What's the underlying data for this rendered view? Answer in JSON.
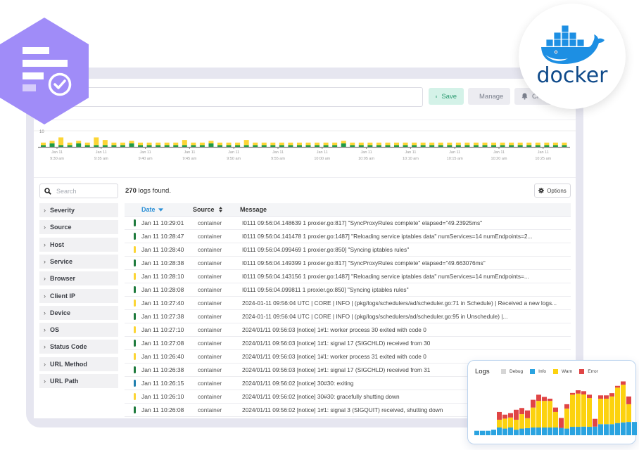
{
  "toolbar": {
    "query_value": "",
    "save_label": "Save",
    "manage_label": "Manage",
    "create_label": "Cr"
  },
  "histogram": {
    "type": "bar",
    "y_tick": "10",
    "ymax": 10,
    "x_ticks": [
      {
        "line1": "Jan 11",
        "line2": "9:30 am"
      },
      {
        "line1": "Jan 11",
        "line2": "9:35 am"
      },
      {
        "line1": "Jan 11",
        "line2": "9:40 am"
      },
      {
        "line1": "Jan 11",
        "line2": "9:45 am"
      },
      {
        "line1": "Jan 11",
        "line2": "9:50 am"
      },
      {
        "line1": "Jan 11",
        "line2": "9:55 am"
      },
      {
        "line1": "Jan 11",
        "line2": "10:00 am"
      },
      {
        "line1": "Jan 11",
        "line2": "10:05 am"
      },
      {
        "line1": "Jan 11",
        "line2": "10:10 am"
      },
      {
        "line1": "Jan 11",
        "line2": "10:15 am"
      },
      {
        "line1": "Jan 11",
        "line2": "10:20 am"
      },
      {
        "line1": "Jan 11",
        "line2": "10:25 am"
      }
    ],
    "colors": {
      "info": "#1e9b45",
      "warn": "#fcd535"
    },
    "info": [
      1,
      2,
      1,
      1,
      2,
      1,
      1,
      1,
      1,
      1,
      2,
      1,
      1,
      1,
      1,
      1,
      1,
      1,
      1,
      2,
      1,
      1,
      1,
      1,
      1,
      1,
      1,
      1,
      1,
      1,
      1,
      1,
      1,
      1,
      2,
      1,
      1,
      1,
      1,
      1,
      1,
      1,
      1,
      1,
      1,
      1,
      1,
      1,
      1,
      1,
      1,
      1,
      1,
      1,
      1,
      1,
      1,
      1,
      1,
      1
    ],
    "warn": [
      1,
      1,
      3,
      1,
      1,
      1,
      3,
      2,
      1,
      1,
      1,
      1,
      1,
      1,
      1,
      1,
      2,
      1,
      1,
      1,
      1,
      1,
      1,
      2,
      1,
      1,
      1,
      1,
      1,
      1,
      1,
      1,
      1,
      1,
      1,
      1,
      1,
      1,
      1,
      1,
      1,
      1,
      1,
      1,
      1,
      1,
      1,
      1,
      1,
      1,
      1,
      1,
      1,
      1,
      1,
      1,
      1,
      1,
      1,
      1
    ]
  },
  "sidebar": {
    "search_placeholder": "Search",
    "facets": [
      "Severity",
      "Source",
      "Host",
      "Service",
      "Browser",
      "Client IP",
      "Device",
      "OS",
      "Status Code",
      "URL Method",
      "URL Path"
    ]
  },
  "results": {
    "count": "270",
    "count_suffix": " logs found.",
    "options_label": "Options",
    "columns": {
      "date": "Date",
      "source": "Source",
      "message": "Message"
    },
    "severity_colors": {
      "info": "#1e7a3c",
      "warn": "#fcd535",
      "debug": "#1f7fae"
    },
    "rows": [
      {
        "sev": "info",
        "date": "Jan 11 10:29:01",
        "source": "container",
        "message": "I0111 09:56:04.148639 1 proxier.go:817] \"SyncProxyRules complete\" elapsed=\"49.23925ms\""
      },
      {
        "sev": "info",
        "date": "Jan 11 10:28:47",
        "source": "container",
        "message": "I0111 09:56:04.141478 1 proxier.go:1487] \"Reloading service iptables data\" numServices=14 numEndpoints=2..."
      },
      {
        "sev": "warn",
        "date": "Jan 11 10:28:40",
        "source": "container",
        "message": "I0111 09:56:04.099469 1 proxier.go:850] \"Syncing iptables rules\""
      },
      {
        "sev": "info",
        "date": "Jan 11 10:28:38",
        "source": "container",
        "message": "I0111 09:56:04.149399 1 proxier.go:817] \"SyncProxyRules complete\" elapsed=\"49.663076ms\""
      },
      {
        "sev": "warn",
        "date": "Jan 11 10:28:10",
        "source": "container",
        "message": "I0111 09:56:04.143156 1 proxier.go:1487] \"Reloading service iptables data\" numServices=14 numEndpoints=..."
      },
      {
        "sev": "info",
        "date": "Jan 11 10:28:08",
        "source": "container",
        "message": "I0111 09:56:04.099811 1 proxier.go:850] \"Syncing iptables rules\""
      },
      {
        "sev": "warn",
        "date": "Jan 11 10:27:40",
        "source": "container",
        "message": "2024-01-11 09:56:04 UTC | CORE | INFO | (pkg/logs/schedulers/ad/scheduler.go:71 in Schedule) | Received a new logs..."
      },
      {
        "sev": "info",
        "date": "Jan 11 10:27:38",
        "source": "container",
        "message": "2024-01-11 09:56:04 UTC | CORE | INFO | (pkg/logs/schedulers/ad/scheduler.go:95 in Unschedule) |..."
      },
      {
        "sev": "warn",
        "date": "Jan 11 10:27:10",
        "source": "container",
        "message": "2024/01/11 09:56:03 [notice] 1#1: worker process 30 exited with code 0"
      },
      {
        "sev": "info",
        "date": "Jan 11 10:27:08",
        "source": "container",
        "message": "2024/01/11 09:56:03 [notice] 1#1: signal 17 (SIGCHLD) received from 30"
      },
      {
        "sev": "warn",
        "date": "Jan 11 10:26:40",
        "source": "container",
        "message": "2024/01/11 09:56:03 [notice] 1#1: worker process 31 exited with code 0"
      },
      {
        "sev": "info",
        "date": "Jan 11 10:26:38",
        "source": "container",
        "message": "2024/01/11 09:56:03 [notice] 1#1: signal 17 (SIGCHLD) received from 31"
      },
      {
        "sev": "debug",
        "date": "Jan 11 10:26:15",
        "source": "container",
        "message": "2024/01/11 09:56:02 [notice] 30#30: exiting"
      },
      {
        "sev": "warn",
        "date": "Jan 11 10:26:10",
        "source": "container",
        "message": "2024/01/11 09:56:02 [notice] 30#30: gracefully shutting down"
      },
      {
        "sev": "info",
        "date": "Jan 11 10:26:08",
        "source": "container",
        "message": "2024/01/11 09:56:02 [notice] 1#1: signal 3 (SIGQUIT) received, shutting down"
      }
    ]
  },
  "docker_logo": {
    "text": "docker",
    "color": "#1d8fe3"
  },
  "chart_data": {
    "type": "bar",
    "title": "Logs",
    "stacked": true,
    "legend": [
      "Debug",
      "Info",
      "Warn",
      "Error"
    ],
    "legend_position": "top",
    "colors": {
      "Debug": "#d6d6d6",
      "Info": "#2aa3e0",
      "Warn": "#fcd20f",
      "Error": "#e04545"
    },
    "series": [
      {
        "name": "Info",
        "values": [
          2,
          2,
          2,
          2.5,
          3.5,
          3,
          3.5,
          2.5,
          3,
          3.2,
          3.5,
          3.5,
          3.5,
          3.5,
          3.5,
          3.3,
          3,
          3.8,
          3.8,
          3.9,
          3.8,
          3.9,
          5,
          5,
          5,
          5.5,
          5.8,
          6,
          6
        ]
      },
      {
        "name": "Warn",
        "values": [
          0,
          0,
          0,
          0,
          3.5,
          4.5,
          4.5,
          4.5,
          6.5,
          4.5,
          9,
          12,
          12,
          12,
          7,
          0,
          9,
          14.5,
          15,
          14.5,
          13,
          0,
          11.5,
          11.5,
          12.5,
          16,
          17,
          8,
          0
        ]
      },
      {
        "name": "Error",
        "values": [
          0,
          0,
          0,
          0,
          3.5,
          1.8,
          2,
          4.5,
          2.8,
          3.5,
          3.5,
          2.8,
          1.8,
          1,
          2,
          4.5,
          2,
          0.8,
          1.5,
          1.5,
          1.5,
          3.5,
          1.5,
          1.5,
          1.5,
          0.8,
          1.5,
          3.5,
          0
        ]
      },
      {
        "name": "Debug",
        "values": [
          0,
          0,
          0,
          0,
          0,
          0,
          0,
          0,
          0,
          0,
          0,
          0,
          0,
          0,
          0,
          0,
          0,
          0,
          0,
          0,
          0,
          0,
          0,
          0,
          0,
          0,
          0,
          0,
          0
        ]
      }
    ]
  }
}
